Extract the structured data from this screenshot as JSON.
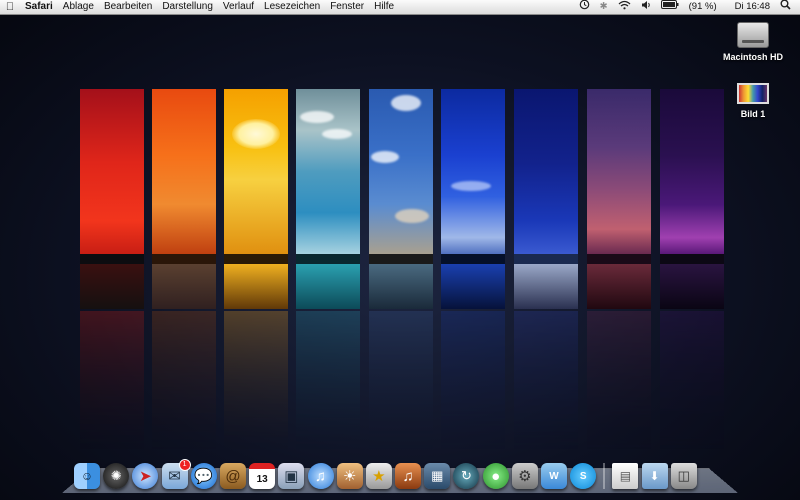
{
  "menubar": {
    "app_name": "Safari",
    "items": [
      "Ablage",
      "Bearbeiten",
      "Darstellung",
      "Verlauf",
      "Lesezeichen",
      "Fenster",
      "Hilfe"
    ],
    "battery": "(91 %)",
    "clock": "Di 16:48"
  },
  "desktop": {
    "icons": [
      {
        "label": "Macintosh HD",
        "icon": "hard-drive-icon"
      },
      {
        "label": "Bild 1",
        "icon": "picture-file-icon"
      }
    ]
  },
  "dock": {
    "apps": [
      {
        "name": "finder",
        "icon": "finder-icon",
        "color": "#3b8fe0"
      },
      {
        "name": "dashboard",
        "icon": "dashboard-icon",
        "color": "#2a2a2a"
      },
      {
        "name": "safari",
        "icon": "safari-icon",
        "color": "#3a7bd5"
      },
      {
        "name": "mail",
        "icon": "mail-icon",
        "color": "#7aa7d8",
        "badge": "1"
      },
      {
        "name": "ichat",
        "icon": "ichat-icon",
        "color": "#3a9ae8"
      },
      {
        "name": "address-book",
        "icon": "address-book-icon",
        "color": "#b8893e"
      },
      {
        "name": "ical",
        "icon": "calendar-icon",
        "color": "#ffffff",
        "label": "13"
      },
      {
        "name": "preview",
        "icon": "preview-icon",
        "color": "#8aa0b8"
      },
      {
        "name": "itunes",
        "icon": "itunes-icon",
        "color": "#4a9de8"
      },
      {
        "name": "iphoto",
        "icon": "iphoto-icon",
        "color": "#d8a060"
      },
      {
        "name": "imovie",
        "icon": "imovie-icon",
        "color": "#c8c8c8"
      },
      {
        "name": "garageband",
        "icon": "garageband-icon",
        "color": "#c26a2a"
      },
      {
        "name": "spaces",
        "icon": "spaces-icon",
        "color": "#4a6a8a"
      },
      {
        "name": "time-machine",
        "icon": "time-machine-icon",
        "color": "#2a5a7a"
      },
      {
        "name": "adium",
        "icon": "adium-icon",
        "color": "#3ab03a"
      },
      {
        "name": "system-preferences",
        "icon": "system-preferences-icon",
        "color": "#9a9a9a"
      },
      {
        "name": "wunderlist",
        "icon": "w-app-icon",
        "color": "#5aa8e8"
      },
      {
        "name": "skype",
        "icon": "skype-icon",
        "color": "#18a0e8",
        "label": "S"
      }
    ],
    "stacks": [
      {
        "name": "document-stack",
        "icon": "document-stack-icon",
        "color": "#eeeeee"
      },
      {
        "name": "downloads-folder",
        "icon": "downloads-folder-icon",
        "color": "#8ab0d8"
      },
      {
        "name": "trash",
        "icon": "trash-icon",
        "color": "#b0b0b0"
      }
    ]
  }
}
